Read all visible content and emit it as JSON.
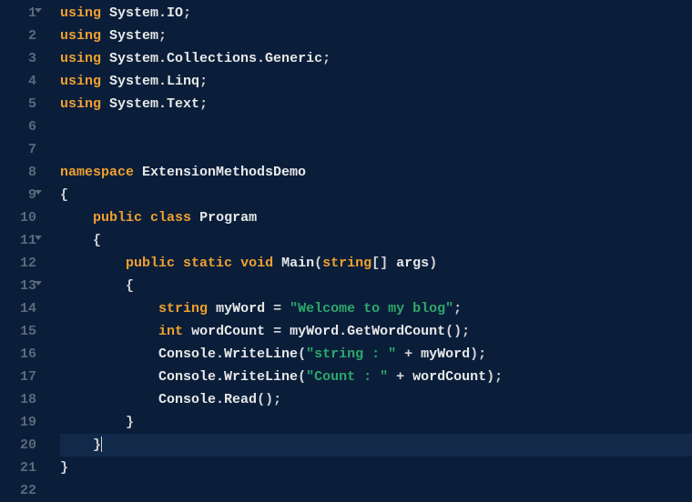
{
  "language": "csharp",
  "active_line": 20,
  "fold_lines": [
    1,
    9,
    11,
    13
  ],
  "indent_guides": [
    36,
    72,
    108,
    144
  ],
  "colors": {
    "background": "#0a1e3a",
    "gutter_fg": "#5a6a7a",
    "keyword": "#f0a030",
    "string": "#2ea86b",
    "default": "#d4d4d4",
    "active_line_bg": "#12294a"
  },
  "lines": [
    {
      "num": 1,
      "tokens": [
        [
          "kw",
          "using"
        ],
        [
          "punc",
          " "
        ],
        [
          "ns",
          "System.IO"
        ],
        [
          "punc",
          ";"
        ]
      ]
    },
    {
      "num": 2,
      "tokens": [
        [
          "kw",
          "using"
        ],
        [
          "punc",
          " "
        ],
        [
          "ns",
          "System"
        ],
        [
          "punc",
          ";"
        ]
      ]
    },
    {
      "num": 3,
      "tokens": [
        [
          "kw",
          "using"
        ],
        [
          "punc",
          " "
        ],
        [
          "ns",
          "System.Collections.Generic"
        ],
        [
          "punc",
          ";"
        ]
      ]
    },
    {
      "num": 4,
      "tokens": [
        [
          "kw",
          "using"
        ],
        [
          "punc",
          " "
        ],
        [
          "ns",
          "System.Linq"
        ],
        [
          "punc",
          ";"
        ]
      ]
    },
    {
      "num": 5,
      "tokens": [
        [
          "kw",
          "using"
        ],
        [
          "punc",
          " "
        ],
        [
          "ns",
          "System.Text"
        ],
        [
          "punc",
          ";"
        ]
      ]
    },
    {
      "num": 6,
      "tokens": []
    },
    {
      "num": 7,
      "tokens": []
    },
    {
      "num": 8,
      "tokens": [
        [
          "kw",
          "namespace"
        ],
        [
          "punc",
          " "
        ],
        [
          "ns",
          "ExtensionMethodsDemo"
        ]
      ]
    },
    {
      "num": 9,
      "tokens": [
        [
          "punc",
          "{"
        ]
      ]
    },
    {
      "num": 10,
      "indent": 1,
      "tokens": [
        [
          "kw",
          "public"
        ],
        [
          "punc",
          " "
        ],
        [
          "kw",
          "class"
        ],
        [
          "punc",
          " "
        ],
        [
          "cls",
          "Program"
        ]
      ]
    },
    {
      "num": 11,
      "indent": 1,
      "tokens": [
        [
          "punc",
          "{"
        ]
      ]
    },
    {
      "num": 12,
      "indent": 2,
      "tokens": [
        [
          "kw",
          "public"
        ],
        [
          "punc",
          " "
        ],
        [
          "kw",
          "static"
        ],
        [
          "punc",
          " "
        ],
        [
          "kw",
          "void"
        ],
        [
          "punc",
          " "
        ],
        [
          "mth",
          "Main"
        ],
        [
          "punc",
          "("
        ],
        [
          "type",
          "string"
        ],
        [
          "punc",
          "[] "
        ],
        [
          "ns",
          "args"
        ],
        [
          "punc",
          ")"
        ]
      ]
    },
    {
      "num": 13,
      "indent": 2,
      "tokens": [
        [
          "punc",
          "{"
        ]
      ]
    },
    {
      "num": 14,
      "indent": 3,
      "tokens": [
        [
          "type",
          "string"
        ],
        [
          "punc",
          " "
        ],
        [
          "ns",
          "myWord"
        ],
        [
          "punc",
          " = "
        ],
        [
          "str",
          "\"Welcome to my blog\""
        ],
        [
          "punc",
          ";"
        ]
      ]
    },
    {
      "num": 15,
      "indent": 3,
      "tokens": [
        [
          "type",
          "int"
        ],
        [
          "punc",
          " "
        ],
        [
          "ns",
          "wordCount"
        ],
        [
          "punc",
          " = "
        ],
        [
          "ns",
          "myWord.GetWordCount"
        ],
        [
          "punc",
          "();"
        ]
      ]
    },
    {
      "num": 16,
      "indent": 3,
      "tokens": [
        [
          "ns",
          "Console.WriteLine"
        ],
        [
          "punc",
          "("
        ],
        [
          "str",
          "\"string : \""
        ],
        [
          "punc",
          " + "
        ],
        [
          "ns",
          "myWord"
        ],
        [
          "punc",
          ");"
        ]
      ]
    },
    {
      "num": 17,
      "indent": 3,
      "tokens": [
        [
          "ns",
          "Console.WriteLine"
        ],
        [
          "punc",
          "("
        ],
        [
          "str",
          "\"Count : \""
        ],
        [
          "punc",
          " + "
        ],
        [
          "ns",
          "wordCount"
        ],
        [
          "punc",
          ");"
        ]
      ]
    },
    {
      "num": 18,
      "indent": 3,
      "tokens": [
        [
          "ns",
          "Console.Read"
        ],
        [
          "punc",
          "();"
        ]
      ]
    },
    {
      "num": 19,
      "indent": 2,
      "tokens": [
        [
          "punc",
          "}"
        ]
      ]
    },
    {
      "num": 20,
      "indent": 1,
      "tokens": [
        [
          "punc",
          "}"
        ]
      ],
      "cursor_after": true
    },
    {
      "num": 21,
      "tokens": [
        [
          "punc",
          "}"
        ]
      ]
    },
    {
      "num": 22,
      "tokens": []
    }
  ]
}
